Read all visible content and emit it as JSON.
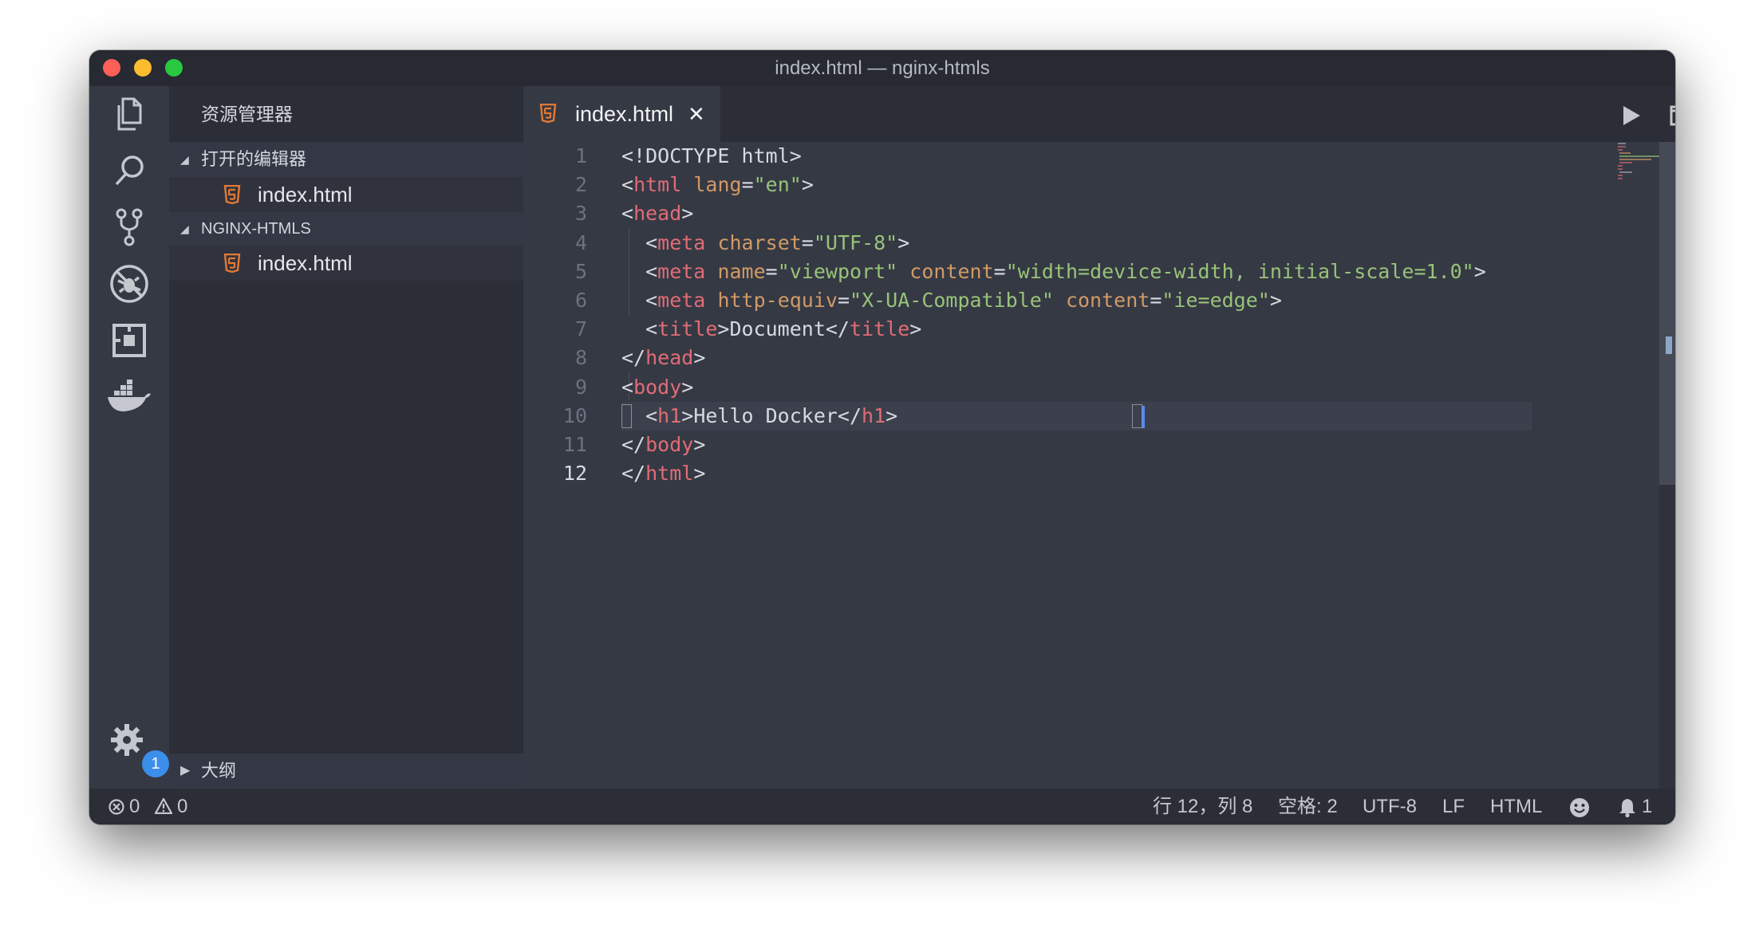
{
  "window": {
    "title": "index.html — nginx-htmls"
  },
  "sidebar": {
    "title": "资源管理器",
    "open_editors": {
      "label": "打开的编辑器",
      "files": [
        "index.html"
      ]
    },
    "folder": {
      "label": "NGINX-HTMLS",
      "files": [
        "index.html"
      ]
    },
    "outline": {
      "label": "大纲"
    }
  },
  "activity_bar": {
    "icons": [
      "explorer-icon",
      "search-icon",
      "source-control-icon",
      "debug-icon",
      "extensions-icon",
      "docker-icon",
      "settings-gear-icon"
    ],
    "settings_badge": "1"
  },
  "tabs": [
    {
      "label": "index.html",
      "close": "✕"
    }
  ],
  "editor": {
    "active_line": 12,
    "lines": [
      {
        "n": "1",
        "tokens": [
          [
            "pl",
            "<!DOCTYPE html>"
          ]
        ]
      },
      {
        "n": "2",
        "tokens": [
          [
            "pl",
            "<"
          ],
          [
            "tg",
            "html"
          ],
          [
            "pl",
            " "
          ],
          [
            "at",
            "lang"
          ],
          [
            "pl",
            "="
          ],
          [
            "st",
            "\"en\""
          ],
          [
            "pl",
            ">"
          ]
        ]
      },
      {
        "n": "3",
        "tokens": [
          [
            "pl",
            "<"
          ],
          [
            "tg",
            "head"
          ],
          [
            "pl",
            ">"
          ]
        ]
      },
      {
        "n": "4",
        "tokens": [
          [
            "pl",
            "  <"
          ],
          [
            "tg",
            "meta"
          ],
          [
            "pl",
            " "
          ],
          [
            "at",
            "charset"
          ],
          [
            "pl",
            "="
          ],
          [
            "st",
            "\"UTF-8\""
          ],
          [
            "pl",
            ">"
          ]
        ]
      },
      {
        "n": "5",
        "tokens": [
          [
            "pl",
            "  <"
          ],
          [
            "tg",
            "meta"
          ],
          [
            "pl",
            " "
          ],
          [
            "at",
            "name"
          ],
          [
            "pl",
            "="
          ],
          [
            "st",
            "\"viewport\""
          ],
          [
            "pl",
            " "
          ],
          [
            "at",
            "content"
          ],
          [
            "pl",
            "="
          ],
          [
            "st",
            "\"width=device-width, initial-scale=1.0\""
          ],
          [
            "pl",
            ">"
          ]
        ]
      },
      {
        "n": "6",
        "tokens": [
          [
            "pl",
            "  <"
          ],
          [
            "tg",
            "meta"
          ],
          [
            "pl",
            " "
          ],
          [
            "at",
            "http-equiv"
          ],
          [
            "pl",
            "="
          ],
          [
            "st",
            "\"X-UA-Compatible\""
          ],
          [
            "pl",
            " "
          ],
          [
            "at",
            "content"
          ],
          [
            "pl",
            "="
          ],
          [
            "st",
            "\"ie=edge\""
          ],
          [
            "pl",
            ">"
          ]
        ]
      },
      {
        "n": "7",
        "tokens": [
          [
            "pl",
            "  <"
          ],
          [
            "tg",
            "title"
          ],
          [
            "pl",
            ">Document</"
          ],
          [
            "tg",
            "title"
          ],
          [
            "pl",
            ">"
          ]
        ]
      },
      {
        "n": "8",
        "tokens": [
          [
            "pl",
            "</"
          ],
          [
            "tg",
            "head"
          ],
          [
            "pl",
            ">"
          ]
        ]
      },
      {
        "n": "9",
        "tokens": [
          [
            "pl",
            "<"
          ],
          [
            "tg",
            "body"
          ],
          [
            "pl",
            ">"
          ]
        ]
      },
      {
        "n": "10",
        "tokens": [
          [
            "pl",
            "  <"
          ],
          [
            "tg",
            "h1"
          ],
          [
            "pl",
            ">Hello Docker</"
          ],
          [
            "tg",
            "h1"
          ],
          [
            "pl",
            ">"
          ]
        ]
      },
      {
        "n": "11",
        "tokens": [
          [
            "pl",
            "</"
          ],
          [
            "tg",
            "body"
          ],
          [
            "pl",
            ">"
          ]
        ]
      },
      {
        "n": "12",
        "tokens": [
          [
            "pl",
            "</"
          ],
          [
            "tg",
            "html"
          ],
          [
            "pl",
            ">"
          ]
        ]
      }
    ]
  },
  "status": {
    "errors": "0",
    "warnings": "0",
    "position": "行 12，列 8",
    "indent": "空格: 2",
    "encoding": "UTF-8",
    "eol": "LF",
    "language": "HTML",
    "notifications": "1"
  },
  "colors": {
    "tag": "#e06c75",
    "attribute": "#d19a66",
    "string": "#98c379",
    "html_icon": "#e37933",
    "badge": "#3b8eea"
  }
}
